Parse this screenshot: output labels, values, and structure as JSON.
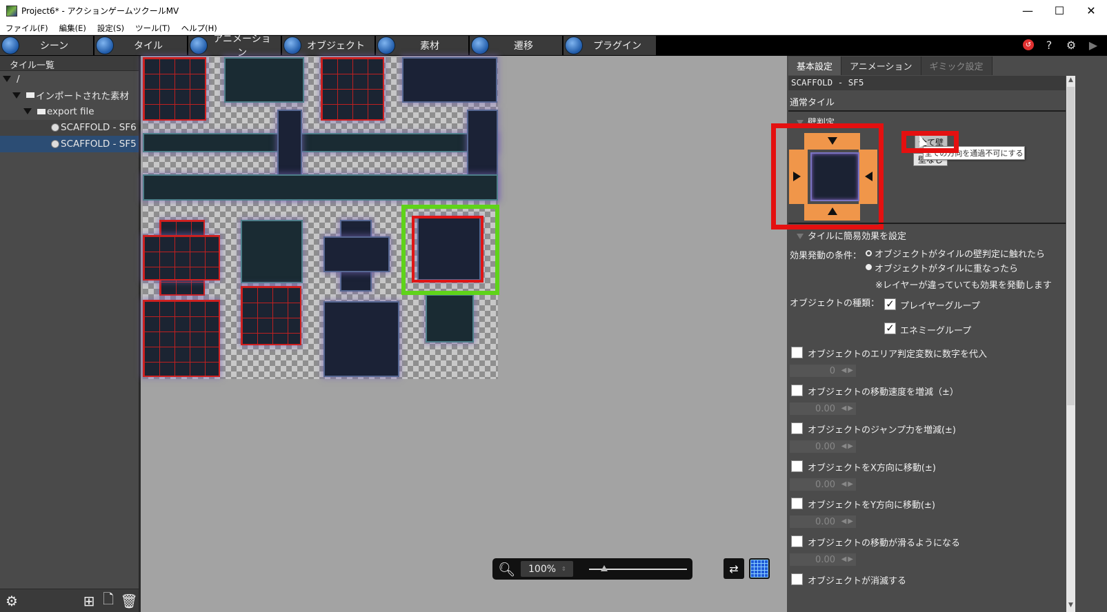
{
  "window": {
    "title": "Project6* - アクションゲームツクールMV",
    "minimize": "—",
    "maximize": "☐",
    "close": "✕"
  },
  "menu": [
    "ファイル(F)",
    "編集(E)",
    "設定(S)",
    "ツール(T)",
    "ヘルプ(H)"
  ],
  "toolbar": {
    "tabs": [
      "シーン",
      "タイル",
      "アニメーション",
      "オブジェクト",
      "素材",
      "遷移",
      "プラグイン"
    ]
  },
  "tile_list": {
    "header": "タイル一覧",
    "root": "/",
    "imported": "インポートされた素材",
    "folder": "export file",
    "items": [
      "SCAFFOLD - SF6",
      "SCAFFOLD - SF5"
    ],
    "selected_index": 1
  },
  "zoom": {
    "value": "100%"
  },
  "properties": {
    "tabs": [
      "基本設定",
      "アニメーション",
      "ギミック設定"
    ],
    "tile_name": "SCAFFOLD - SF5",
    "tile_type": "通常タイル",
    "wall_section": "壁判定",
    "all_wall_button": "全て壁",
    "no_wall_button": "壁なし",
    "tooltip": "全ての方向を通過不可にする",
    "effect_section": "タイルに簡易効果を設定",
    "trigger_label": "効果発動の条件：",
    "trigger_options": [
      "オブジェクトがタイルの壁判定に触れたら",
      "オブジェクトがタイルに重なったら"
    ],
    "trigger_selected": 1,
    "layer_note": "※レイヤーが違っていても効果を発動します",
    "object_type_label": "オブジェクトの種類：",
    "object_types": [
      {
        "label": "プレイヤーグループ",
        "checked": true
      },
      {
        "label": "エネミーグループ",
        "checked": true
      }
    ],
    "effects": [
      {
        "label": "オブジェクトのエリア判定変数に数字を代入",
        "value": "0"
      },
      {
        "label": "オブジェクトの移動速度を増減（±）",
        "value": "0.00"
      },
      {
        "label": "オブジェクトのジャンプ力を増減(±)",
        "value": "0.00"
      },
      {
        "label": "オブジェクトをX方向に移動(±)",
        "value": "0.00"
      },
      {
        "label": "オブジェクトをY方向に移動(±)",
        "value": "0.00"
      },
      {
        "label": "オブジェクトの移動が滑るようになる",
        "value": "0.00"
      },
      {
        "label": "オブジェクトが消滅する",
        "value": ""
      }
    ]
  },
  "colors": {
    "accent_selection": "#5fd31a",
    "highlight_red": "#e41010",
    "wall_orange": "#f0964a"
  }
}
